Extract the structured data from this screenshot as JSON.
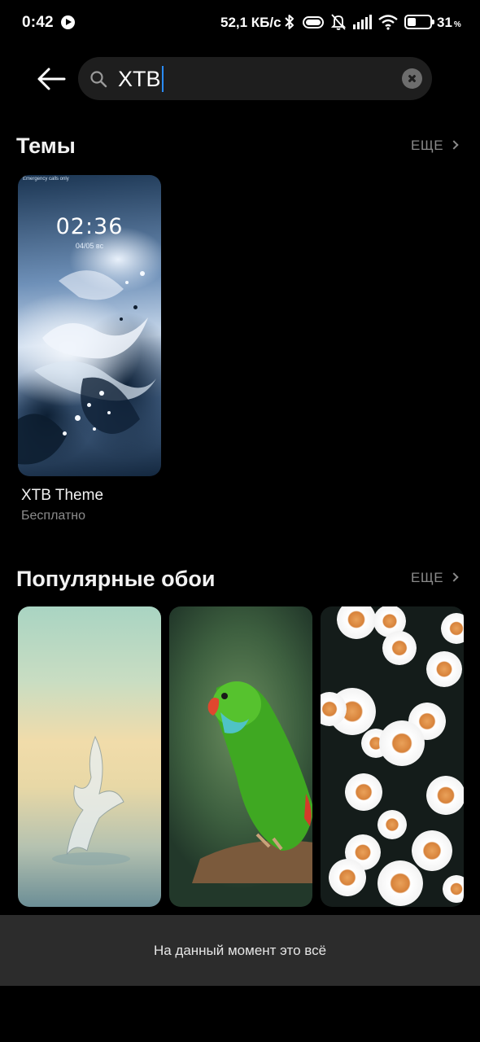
{
  "status_bar": {
    "time": "0:42",
    "network_speed": "52,1 КБ/с",
    "battery_percent": "31",
    "battery_unit": "%",
    "icons": [
      "play-icon",
      "bluetooth-icon",
      "toggle-icon",
      "bell-muted-icon",
      "signal-icon",
      "wifi-icon",
      "battery-icon"
    ]
  },
  "search": {
    "query": "XTB",
    "icons": [
      "back-arrow-icon",
      "search-icon",
      "clear-icon"
    ]
  },
  "themes_section": {
    "title": "Темы",
    "more_label": "ЕЩЕ",
    "items": [
      {
        "name": "XTB Theme",
        "price": "Бесплатно",
        "preview_clock": "02:36",
        "preview_date": "04/05 вс"
      }
    ]
  },
  "wallpapers_section": {
    "title": "Популярные обои",
    "more_label": "ЕЩЕ",
    "items": [
      {
        "subject": "water-splash"
      },
      {
        "subject": "green-parrot"
      },
      {
        "subject": "daisies"
      }
    ]
  },
  "footer": {
    "message": "На данный момент это всё"
  },
  "colors": {
    "background": "#000000",
    "search_box": "#1e1e1e",
    "caret": "#2a8cff",
    "footer_bar": "#2c2c2c",
    "secondary_text": "#8c8c8c"
  }
}
